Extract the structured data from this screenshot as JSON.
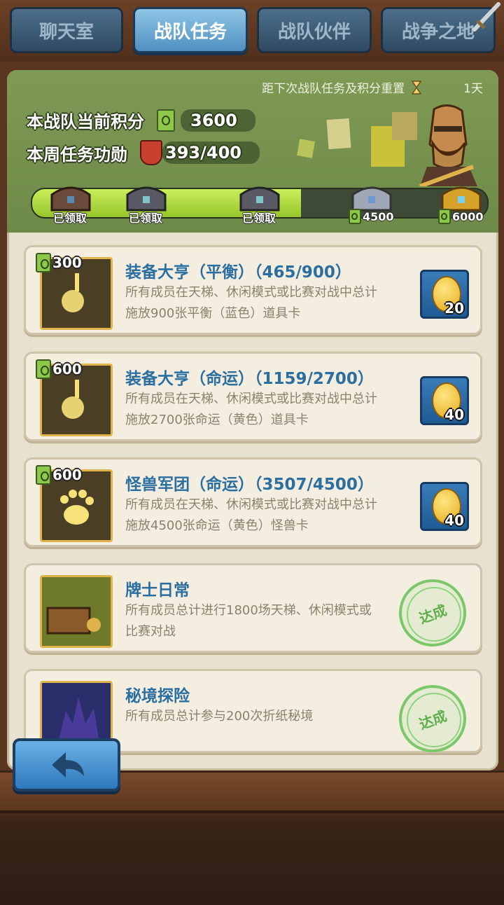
{
  "tabs": [
    {
      "label": "聊天室",
      "active": false
    },
    {
      "label": "战队任务",
      "active": true
    },
    {
      "label": "战队伙伴",
      "active": false
    },
    {
      "label": "战争之地",
      "active": false
    }
  ],
  "header": {
    "reset_label": "距下次战队任务及积分重置",
    "reset_remaining": "1天",
    "points_label": "本战队当前积分",
    "points_value": "3600",
    "merit_label": "本周任务功勋",
    "merit_value": "393/400"
  },
  "progress": {
    "fraction": 0.59,
    "milestones": [
      {
        "label": "已领取",
        "claimed": true
      },
      {
        "label": "已领取",
        "claimed": true
      },
      {
        "label": "已领取",
        "claimed": true
      },
      {
        "label": "4500",
        "claimed": false
      },
      {
        "label": "6000",
        "claimed": false
      }
    ]
  },
  "tasks": [
    {
      "title": "装备大亨（平衡）（465/900）",
      "desc": "所有成员在天梯、休闲模式或比赛对战中总计施放900张平衡（蓝色）道具卡",
      "badge": "300",
      "reward": "20",
      "done": false,
      "thumb_icon": "flask-icon"
    },
    {
      "title": "装备大亨（命运）（1159/2700）",
      "desc": "所有成员在天梯、休闲模式或比赛对战中总计施放2700张命运（黄色）道具卡",
      "badge": "600",
      "reward": "40",
      "done": false,
      "thumb_icon": "flask-icon"
    },
    {
      "title": "怪兽军团（命运）（3507/4500）",
      "desc": "所有成员在天梯、休闲模式或比赛对战中总计施放4500张命运（黄色）怪兽卡",
      "badge": "600",
      "reward": "40",
      "done": false,
      "thumb_icon": "paw-icon"
    },
    {
      "title": "牌士日常",
      "desc": "所有成员总计进行1800场天梯、休闲模式或比赛对战",
      "badge": "",
      "reward": "",
      "done": true,
      "thumb_icon": "table-icon"
    },
    {
      "title": "秘境探险",
      "desc": "所有成员总计参与200次折纸秘境",
      "badge": "",
      "reward": "",
      "done": true,
      "thumb_icon": "castle-icon"
    }
  ],
  "stamp_label": "达成",
  "colors": {
    "accent_blue": "#2b6ea0",
    "header_green": "#7f9a55",
    "bar_green": "#b6e046"
  }
}
